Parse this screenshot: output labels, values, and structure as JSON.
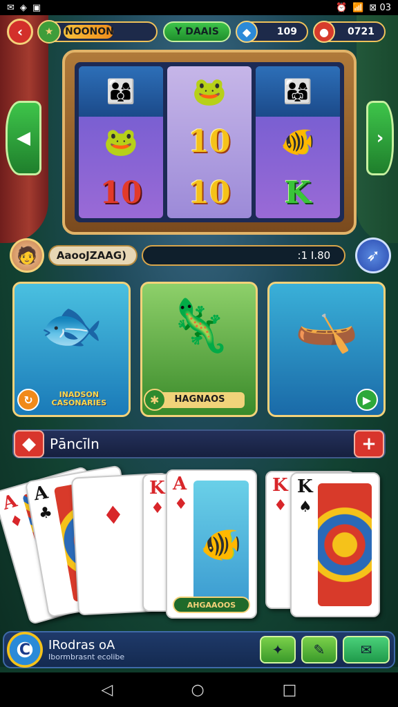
{
  "status_bar": {
    "time": "",
    "right_text": "⊠ 03"
  },
  "topbar": {
    "player_name": "NOONON",
    "player_progress": 0.55,
    "mode_label": "Y DAAIS",
    "gems_value": "109",
    "coins_value": "0721"
  },
  "slot": {
    "reels": [
      [
        "👨‍👩‍👦",
        "🐸",
        "10"
      ],
      [
        "🐸",
        "10",
        "10"
      ],
      [
        "👨‍👩‍👧",
        "🐠",
        "K"
      ]
    ]
  },
  "info": {
    "player_tag": "AaooJZAAG)",
    "score": ":1 I.80"
  },
  "games": [
    {
      "label": "INADSON CASONARIES",
      "art": "🐟"
    },
    {
      "label": "HAGNAOS",
      "art": "🦎"
    },
    {
      "label": "",
      "art": "🛶"
    }
  ],
  "section": {
    "title": "Pāncīln"
  },
  "cards": {
    "c1": {
      "rank": "A",
      "suit": "♦"
    },
    "c2": {
      "rank": "A",
      "suit": "♣"
    },
    "c3": {
      "rank": "",
      "suit": "♦"
    },
    "c4": {
      "rank": "K",
      "suit": "♦"
    },
    "c5": {
      "rank": "A",
      "suit": "♦",
      "label": "AHGAAOOS"
    },
    "c6": {
      "rank": "K",
      "suit": "♦"
    },
    "c7": {
      "rank": "K",
      "suit": "♠"
    }
  },
  "bottom_bar": {
    "title": "IRodras oA",
    "subtitle": "Ibormbrasnt ecolibe"
  },
  "colors": {
    "accent_gold": "#f4d27a",
    "danger_red": "#d8352c",
    "success_green": "#3ec44a"
  }
}
